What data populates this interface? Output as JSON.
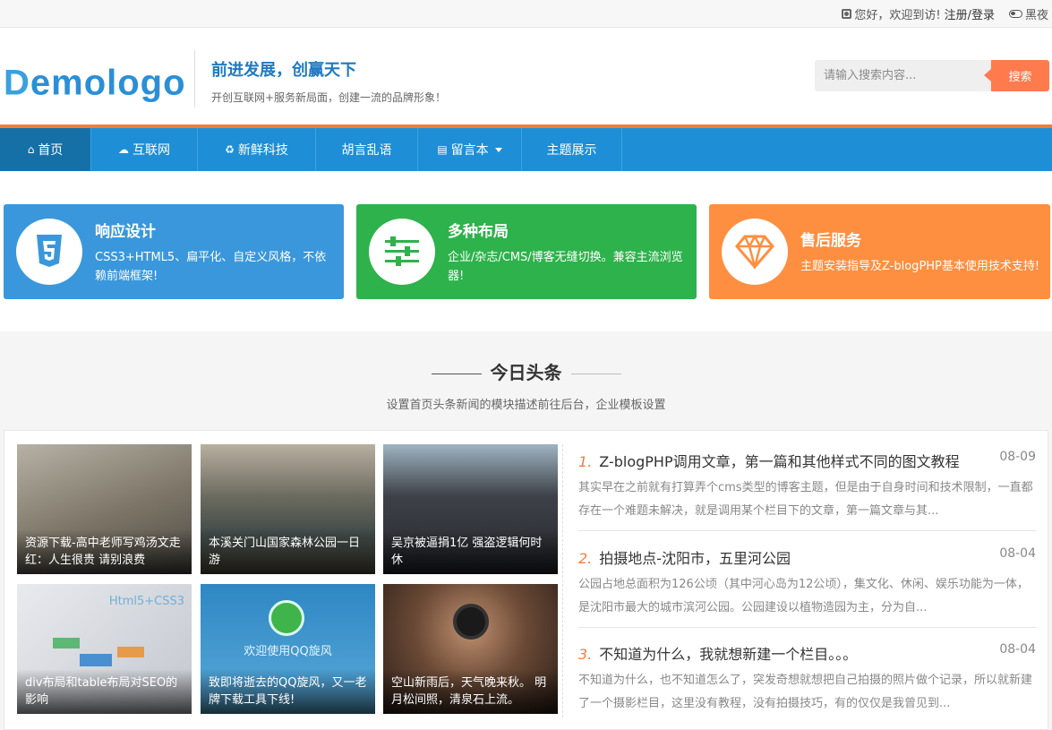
{
  "topbar": {
    "greeting": "您好，欢迎到访!",
    "login_label": "注册/登录",
    "night_label": "黑夜"
  },
  "header": {
    "logo_first": "D",
    "logo_rest": "emologo",
    "slogan_title": "前进发展，创赢天下",
    "slogan_sub": "开创互联网+服务新局面，创建一流的品牌形象！",
    "search_placeholder": "请输入搜索内容...",
    "search_button": "搜索"
  },
  "nav": {
    "items": [
      {
        "label": "首页",
        "icon": "home-icon"
      },
      {
        "label": "互联网",
        "icon": "cloud-icon"
      },
      {
        "label": "新鲜科技",
        "icon": "recycle-icon"
      },
      {
        "label": "胡言乱语",
        "icon": ""
      },
      {
        "label": "留言本",
        "icon": "book-icon"
      },
      {
        "label": "主题展示",
        "icon": ""
      }
    ]
  },
  "features": [
    {
      "title": "响应设计",
      "desc": "CSS3+HTML5、扁平化、自定义风格，不依赖前端框架!",
      "color": "#3a97db",
      "icon": "html5-icon"
    },
    {
      "title": "多种布局",
      "desc": "企业/杂志/CMS/博客无缝切换。兼容主流浏览器!",
      "color": "#2eb24c",
      "icon": "sliders-icon"
    },
    {
      "title": "售后服务",
      "desc": "主题安装指导及Z-blogPHP基本使用技术支持!",
      "color": "#ff8f40",
      "icon": "diamond-icon"
    }
  ],
  "news": {
    "title": "今日头条",
    "desc": "设置首页头条新闻的模块描述前往后台，企业模板设置",
    "thumbs": [
      {
        "caption": "资源下载-高中老师写鸡汤文走红：人生很贵 请别浪费",
        "color": "#8a8070"
      },
      {
        "caption": "本溪关门山国家森林公园一日游",
        "color": "#5e5a4c"
      },
      {
        "caption": "吴京被逼捐1亿 强盗逻辑何时休",
        "color": "#4a4a55"
      },
      {
        "caption": "div布局和table布局对SEO的影响",
        "color": "#c9ccd2",
        "overlay": "Html5+CSS3"
      },
      {
        "caption": "致即将逝去的QQ旋风，又一老牌下载工具下线!",
        "color": "#3b8fc7",
        "overlay": "欢迎使用QQ旋风"
      },
      {
        "caption": "空山新雨后，天气晚来秋。 明月松间照，清泉石上流。",
        "color": "#6b4a36"
      }
    ],
    "articles": [
      {
        "num": "1.",
        "title": "Z-blogPHP调用文章，第一篇和其他样式不同的图文教程",
        "date": "08-09",
        "excerpt": "其实早在之前就有打算弄个cms类型的博客主题，但是由于自身时间和技术限制，一直都存在一个难题未解决，就是调用某个栏目下的文章，第一篇文章与其..."
      },
      {
        "num": "2.",
        "title": "拍摄地点-沈阳市，五里河公园",
        "date": "08-04",
        "excerpt": "公园占地总面积为126公顷（其中河心岛为12公顷），集文化、休闲、娱乐功能为一体，是沈阳市最大的城市滨河公园。公园建设以植物造园为主，分为自..."
      },
      {
        "num": "3.",
        "title": "不知道为什么，我就想新建一个栏目。。。",
        "date": "08-04",
        "excerpt": "不知道为什么，也不知道怎么了，突发奇想就想把自己拍摄的照片做个记录，所以就新建了一个摄影栏目，这里没有教程，没有拍摄技巧，有的仅仅是我曾见到..."
      }
    ]
  }
}
